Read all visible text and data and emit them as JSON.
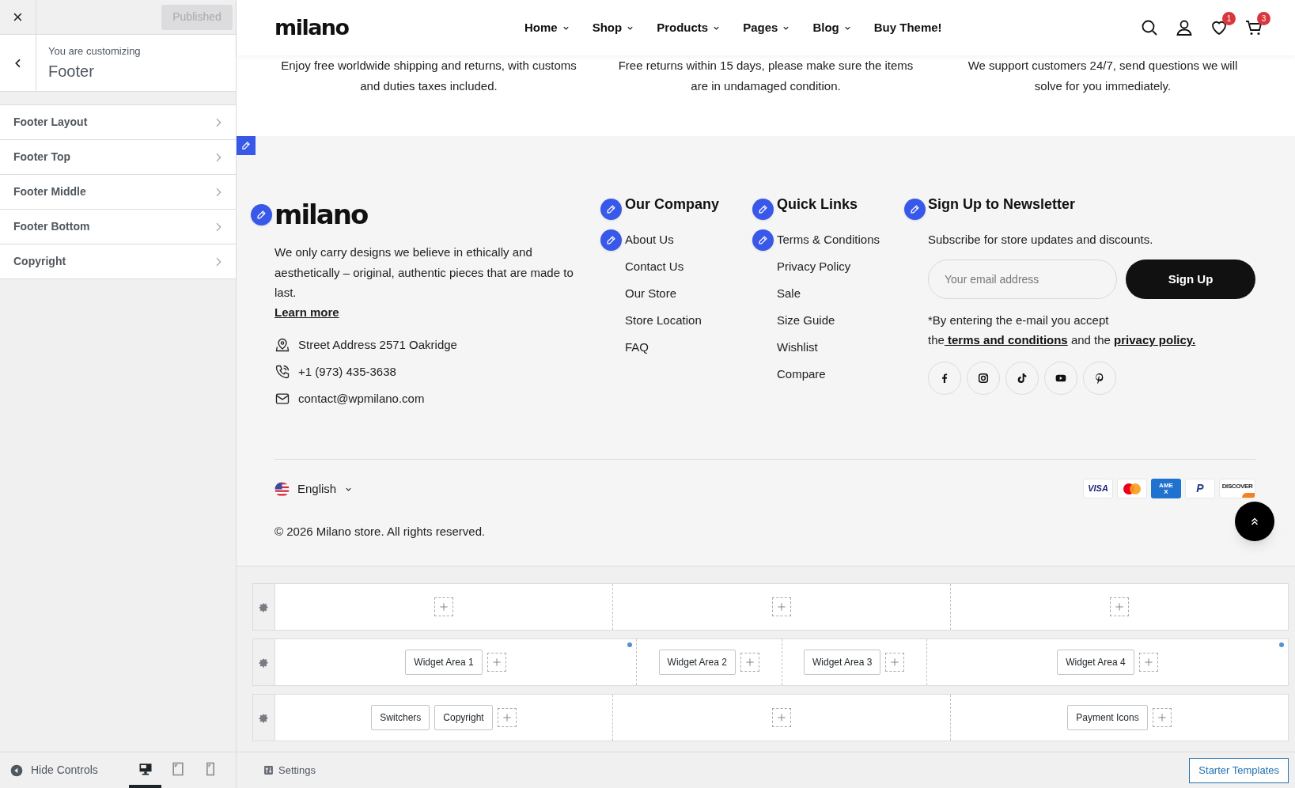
{
  "customizer": {
    "close": "×",
    "publish_button": {
      "label": "Published",
      "disabled": true
    },
    "subtitle": "You are customizing",
    "title": "Footer",
    "sections": [
      {
        "label": "Footer Layout"
      },
      {
        "label": "Footer Top"
      },
      {
        "label": "Footer Middle"
      },
      {
        "label": "Footer Bottom"
      },
      {
        "label": "Copyright"
      }
    ],
    "hide_controls": "Hide Controls",
    "devices": [
      {
        "kind": "desktop",
        "selected": true
      },
      {
        "kind": "tablet",
        "selected": false
      },
      {
        "kind": "mobile",
        "selected": false
      }
    ]
  },
  "site": {
    "header": {
      "logo": "milano",
      "nav": [
        {
          "label": "Home",
          "dropdown": true
        },
        {
          "label": "Shop",
          "dropdown": true
        },
        {
          "label": "Products",
          "dropdown": true
        },
        {
          "label": "Pages",
          "dropdown": true
        },
        {
          "label": "Blog",
          "dropdown": true
        },
        {
          "label": "Buy Theme!",
          "dropdown": false
        }
      ],
      "wishlist_count": "1",
      "cart_count": "3"
    },
    "features": [
      [
        "Enjoy free worldwide shipping and returns, with customs",
        "and duties taxes included."
      ],
      [
        "Free returns within 15 days, please make sure the items",
        "are in undamaged condition."
      ],
      [
        "We support customers 24/7, send questions we will",
        "solve for you immediately."
      ]
    ],
    "footer": {
      "logo": "milano",
      "about": "We only carry designs we believe in ethically and aesthetically – original, authentic pieces that are made to last.",
      "learn_more": "Learn more",
      "contacts": [
        {
          "kind": "address",
          "text": "Street Address 2571 Oakridge"
        },
        {
          "kind": "phone",
          "text": "+1 (973) 435-3638"
        },
        {
          "kind": "email",
          "text": "contact@wpmilano.com"
        }
      ],
      "columns": [
        {
          "heading": "Our Company",
          "links": [
            {
              "label": "About Us",
              "edit_shortcut": true
            },
            {
              "label": "Contact Us",
              "edit_shortcut": false
            },
            {
              "label": "Our Store",
              "edit_shortcut": false
            },
            {
              "label": "Store Location",
              "edit_shortcut": false
            },
            {
              "label": "FAQ",
              "edit_shortcut": false
            }
          ]
        },
        {
          "heading": "Quick Links",
          "links": [
            {
              "label": "Terms & Conditions",
              "edit_shortcut": true
            },
            {
              "label": "Privacy Policy",
              "edit_shortcut": false
            },
            {
              "label": "Sale",
              "edit_shortcut": false
            },
            {
              "label": "Size Guide",
              "edit_shortcut": false
            },
            {
              "label": "Wishlist",
              "edit_shortcut": false
            },
            {
              "label": "Compare",
              "edit_shortcut": false
            }
          ]
        }
      ],
      "newsletter": {
        "heading": "Sign Up to Newsletter",
        "text": "Subscribe for store updates and discounts.",
        "placeholder": "Your email address",
        "button": "Sign Up",
        "note_parts": [
          {
            "kind": "text",
            "text": "*By entering the e-mail you accept the"
          },
          {
            "kind": "link",
            "text": " terms and conditions"
          },
          {
            "kind": "text",
            "text": " and the "
          },
          {
            "kind": "link",
            "text": "privacy policy."
          }
        ]
      },
      "socials": [
        {
          "kind": "facebook"
        },
        {
          "kind": "instagram"
        },
        {
          "kind": "tiktok"
        },
        {
          "kind": "youtube"
        },
        {
          "kind": "pinterest"
        }
      ],
      "language": "English",
      "copyright": "© 2026 Milano store. All rights reserved.",
      "payments": [
        {
          "kind": "visa",
          "label": "VISA"
        },
        {
          "kind": "mastercard"
        },
        {
          "kind": "amex",
          "label": "AMEX"
        },
        {
          "kind": "paypal",
          "label": "P"
        },
        {
          "kind": "discover",
          "label": "DISCOVER"
        }
      ]
    }
  },
  "builder": {
    "rows": [
      {
        "zones": [
          {
            "marker": false
          },
          {
            "marker": false
          },
          {
            "marker": false
          }
        ]
      },
      {
        "zones": [
          {
            "items": [
              "Widget Area 1"
            ],
            "marker": true
          },
          {
            "items": [
              "Widget Area 2"
            ],
            "marker": false
          },
          {
            "items": [
              "Widget Area 3"
            ],
            "marker": false
          },
          {
            "items": [
              "Widget Area 4"
            ],
            "marker": true
          }
        ]
      },
      {
        "zones": [
          {
            "items": [
              "Switchers",
              "Copyright"
            ],
            "marker": false
          },
          {
            "marker": false
          },
          {
            "items": [
              "Payment Icons"
            ],
            "marker": false
          }
        ]
      }
    ],
    "settings": "Settings",
    "starter_templates": "Starter Templates"
  }
}
